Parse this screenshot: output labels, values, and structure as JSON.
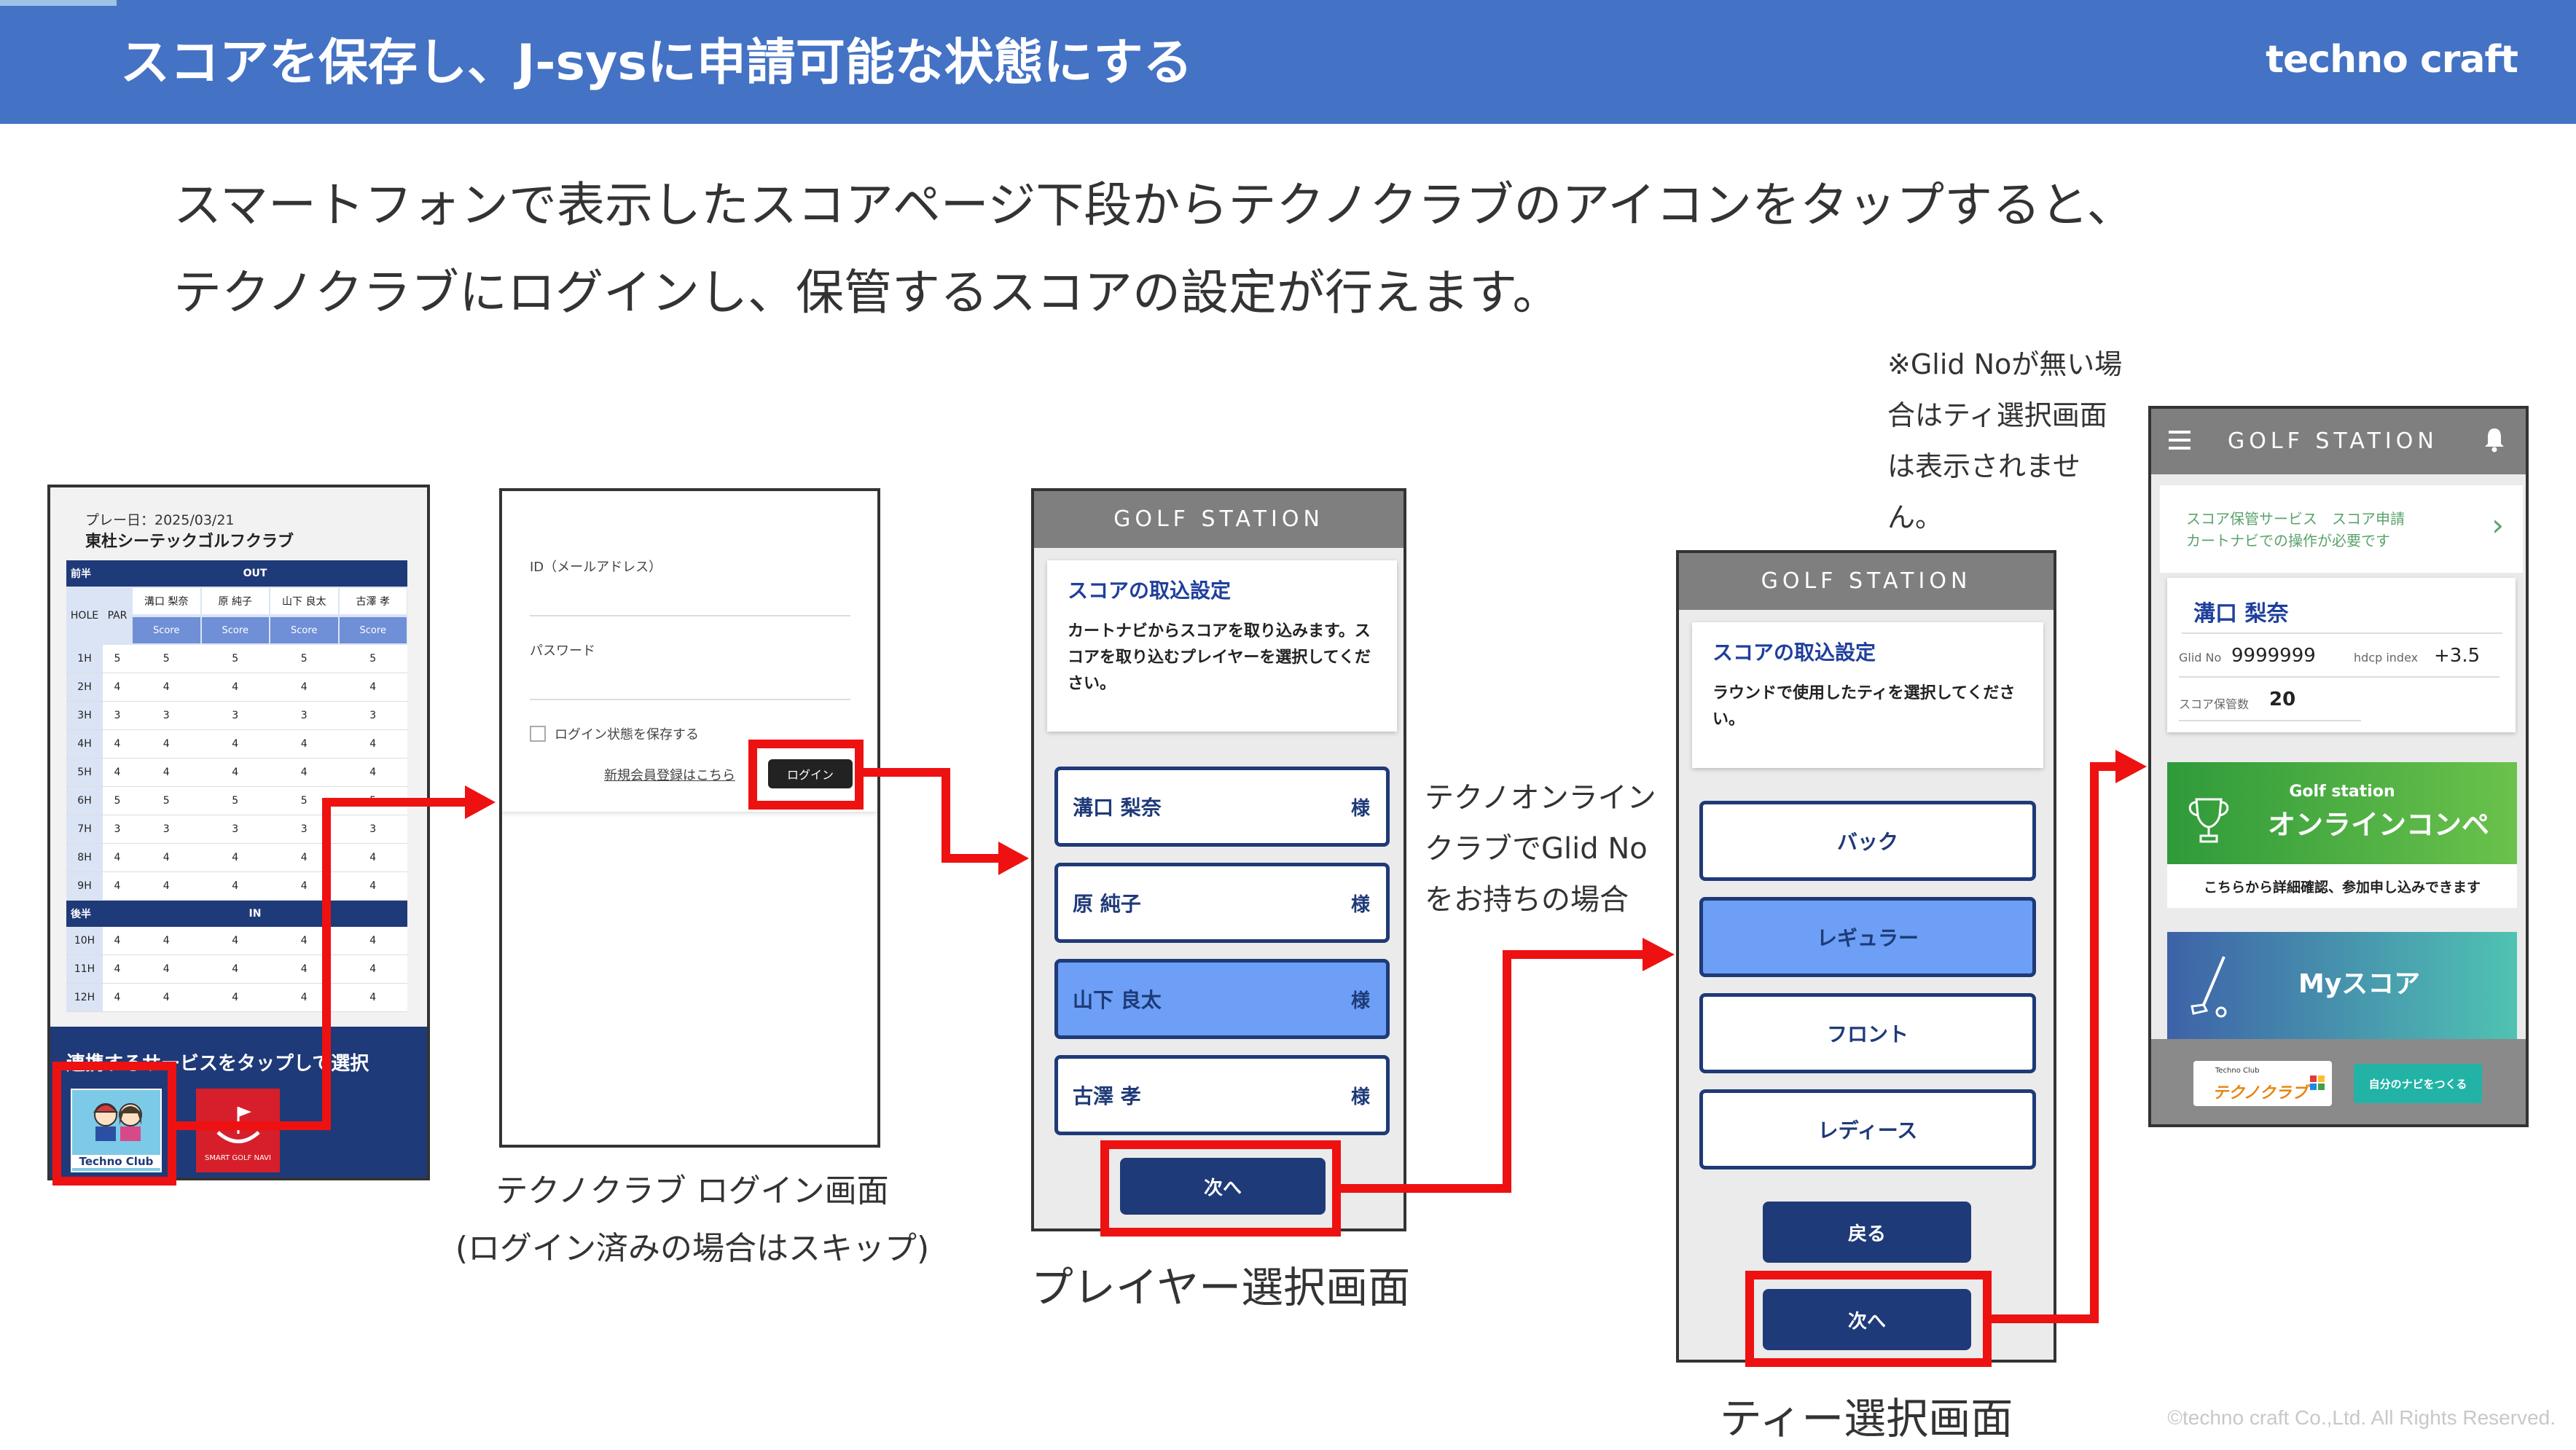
{
  "header": {
    "title": "スコアを保存し、J-sysに申請可能な状態にする",
    "logo": "techno craft"
  },
  "lead": {
    "line1": "スマートフォンで表示したスコアページ下段からテクノクラブのアイコンをタップすると、",
    "line2": "テクノクラブにログインし、保管するスコアの設定が行えます。"
  },
  "note": "※Glid Noが無い場合はティ選択画面は表示されません。",
  "condition": "テクノオンラインクラブでGlid Noをお持ちの場合",
  "captions": {
    "login1": "テクノクラブ ログイン画面",
    "login2": "(ログイン済みの場合はスキップ)",
    "player": "プレイヤー選択画面",
    "tee": "ティー選択画面"
  },
  "copyright": "©techno craft Co.,Ltd. All Rights Reserved.",
  "score_screen": {
    "date": "プレー日：2025/03/21",
    "club": "東杜シーテックゴルフクラブ",
    "front_label": "前半",
    "out_label": "OUT",
    "back_label": "後半",
    "in_label": "IN",
    "hole_label": "HOLE",
    "par_label": "PAR",
    "score_label": "Score",
    "players": [
      "溝口 梨奈",
      "原 純子",
      "山下 良太",
      "古澤 孝"
    ],
    "front_rows": [
      {
        "hole": "1H",
        "par": "5",
        "scores": [
          "5",
          "5",
          "5",
          "5"
        ]
      },
      {
        "hole": "2H",
        "par": "4",
        "scores": [
          "4",
          "4",
          "4",
          "4"
        ]
      },
      {
        "hole": "3H",
        "par": "3",
        "scores": [
          "3",
          "3",
          "3",
          "3"
        ]
      },
      {
        "hole": "4H",
        "par": "4",
        "scores": [
          "4",
          "4",
          "4",
          "4"
        ]
      },
      {
        "hole": "5H",
        "par": "4",
        "scores": [
          "4",
          "4",
          "4",
          "4"
        ]
      },
      {
        "hole": "6H",
        "par": "5",
        "scores": [
          "5",
          "5",
          "5",
          "5"
        ]
      },
      {
        "hole": "7H",
        "par": "3",
        "scores": [
          "3",
          "3",
          "3",
          "3"
        ]
      },
      {
        "hole": "8H",
        "par": "4",
        "scores": [
          "4",
          "4",
          "4",
          "4"
        ]
      },
      {
        "hole": "9H",
        "par": "4",
        "scores": [
          "4",
          "4",
          "4",
          "4"
        ]
      }
    ],
    "back_rows": [
      {
        "hole": "10H",
        "par": "4",
        "scores": [
          "4",
          "4",
          "4",
          "4"
        ]
      },
      {
        "hole": "11H",
        "par": "4",
        "scores": [
          "4",
          "4",
          "4",
          "4"
        ]
      },
      {
        "hole": "12H",
        "par": "4",
        "scores": [
          "4",
          "4",
          "4",
          "4"
        ]
      }
    ],
    "service_prompt": "連携するサービスをタップして選択",
    "techno_club_label": "Techno Club",
    "smart_golf_label": "SMART GOLF NAVI"
  },
  "login_screen": {
    "id_label": "ID（メールアドレス）",
    "password_label": "パスワード",
    "remember_label": "ログイン状態を保存する",
    "register_link": "新規会員登録はこちら",
    "login_button": "ログイン"
  },
  "player_screen": {
    "app_title": "GOLF STATION",
    "card_title": "スコアの取込設定",
    "card_body": "カートナビからスコアを取り込みます。スコアを取り込むプレイヤーを選択してください。",
    "players": [
      {
        "name": "溝口 梨奈",
        "suffix": "様",
        "selected": false
      },
      {
        "name": "原 純子",
        "suffix": "様",
        "selected": false
      },
      {
        "name": "山下 良太",
        "suffix": "様",
        "selected": true
      },
      {
        "name": "古澤 孝",
        "suffix": "様",
        "selected": false
      }
    ],
    "next_button": "次へ"
  },
  "tee_screen": {
    "app_title": "GOLF STATION",
    "card_title": "スコアの取込設定",
    "card_body": "ラウンドで使用したティを選択してください。",
    "tees": [
      {
        "name": "バック",
        "selected": false
      },
      {
        "name": "レギュラー",
        "selected": true
      },
      {
        "name": "フロント",
        "selected": false
      },
      {
        "name": "レディース",
        "selected": false
      }
    ],
    "back_button": "戻る",
    "next_button": "次へ"
  },
  "home_screen": {
    "app_title": "GOLF STATION",
    "info_line1": "スコア保管サービス　スコア申請",
    "info_line2": "カートナビでの操作が必要です",
    "user_name": "溝口 梨奈",
    "glid_label": "Glid No",
    "glid_value": "9999999",
    "hdcp_label": "hdcp index",
    "hdcp_value": "+3.5",
    "stored_label": "スコア保管数",
    "stored_value": "20",
    "competition_sub": "Golf station",
    "competition_title": "オンラインコンペ",
    "competition_desc": "こちらから詳細確認、参加申し込みできます",
    "myscore_title": "Myスコア",
    "techno_club_small": "Techno Club",
    "techno_club_logo": "テクノクラブ",
    "navi_button": "自分のナビをつくる"
  },
  "colors": {
    "header": "#4472c4",
    "highlight": "#ee1111",
    "navy": "#1f3a78",
    "selected": "#6c9ff5"
  }
}
